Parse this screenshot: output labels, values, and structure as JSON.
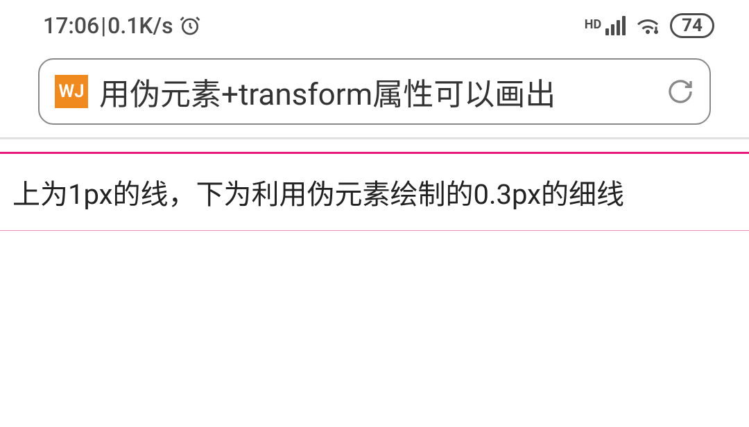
{
  "statusbar": {
    "time": "17:06",
    "separator": " | ",
    "speed": "0.1K/s",
    "hd_label": "HD",
    "battery": "74"
  },
  "browser": {
    "favicon_text": "WJ",
    "page_title": "用伪元素+transform属性可以画出"
  },
  "content": {
    "caption": "上为1px的线，下为利用伪元素绘制的0.3px的细线"
  },
  "colors": {
    "accent": "#e6197f",
    "favicon_bg": "#f08a1f"
  }
}
